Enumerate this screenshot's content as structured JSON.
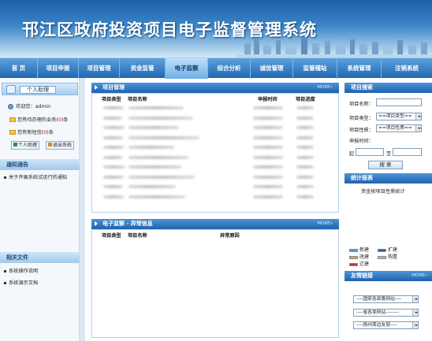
{
  "banner": {
    "title": "邗江区政府投资项目电子监督管理系统"
  },
  "nav": {
    "items": [
      "首 页",
      "项目申报",
      "项目管理",
      "资金监管",
      "电子监察",
      "综合分析",
      "诚信管理",
      "监管稽站",
      "系统管理",
      "注销系统"
    ],
    "active_index": 4
  },
  "left": {
    "assistant_title": "个人助理",
    "welcome_prefix": "欢迎您：",
    "user": "admin",
    "pending_business_prefix": "您有待办理的业务(",
    "pending_business_count": "0",
    "pending_business_suffix": ")条",
    "new_message_prefix": "您有新短信(",
    "new_message_count": "0",
    "new_message_suffix": ")条",
    "personal_assistant_button": "个人助理",
    "logout_button": "退出系统",
    "notice_title": "通知通告",
    "notices": [
      "关于开展系统试运行的通知"
    ],
    "files_title": "相关文件",
    "files": [
      "系统操作说明",
      "系统演示文档"
    ]
  },
  "project_panel": {
    "title": "项目管理",
    "more": "MORE»",
    "columns": [
      "项目类型",
      "项目名称",
      "申报时间",
      "项目进度"
    ]
  },
  "monitor_panel": {
    "title": "电子监察 - 异常信息",
    "more": "MORE»",
    "columns": [
      "项目类型",
      "项目名称",
      "异常原因"
    ]
  },
  "search": {
    "title": "项目搜索",
    "name_label": "项目名称：",
    "type_label": "项目类型：",
    "type_value": "==项目类型==",
    "nature_label": "项目性质：",
    "nature_value": "==项目性质==",
    "date_label": "申报时间：",
    "from_label": "起",
    "to_label": "至",
    "button": "搜 索"
  },
  "stats": {
    "title": "统计报表",
    "link": "资金按项目性质统计",
    "legend": [
      {
        "label": "新建",
        "color": "#5b9bd5"
      },
      {
        "label": "扩建",
        "color": "#2f5f96"
      },
      {
        "label": "改建",
        "color": "#e8a23a"
      },
      {
        "label": "购置",
        "color": "#b8b8b8"
      },
      {
        "label": "迁建",
        "color": "#c8342c"
      }
    ]
  },
  "friends": {
    "title": "友情链接",
    "more": "MORE»",
    "options": [
      "----国家各部委网站----",
      "----省各类网站--------",
      "----扬州周边友就----"
    ]
  }
}
